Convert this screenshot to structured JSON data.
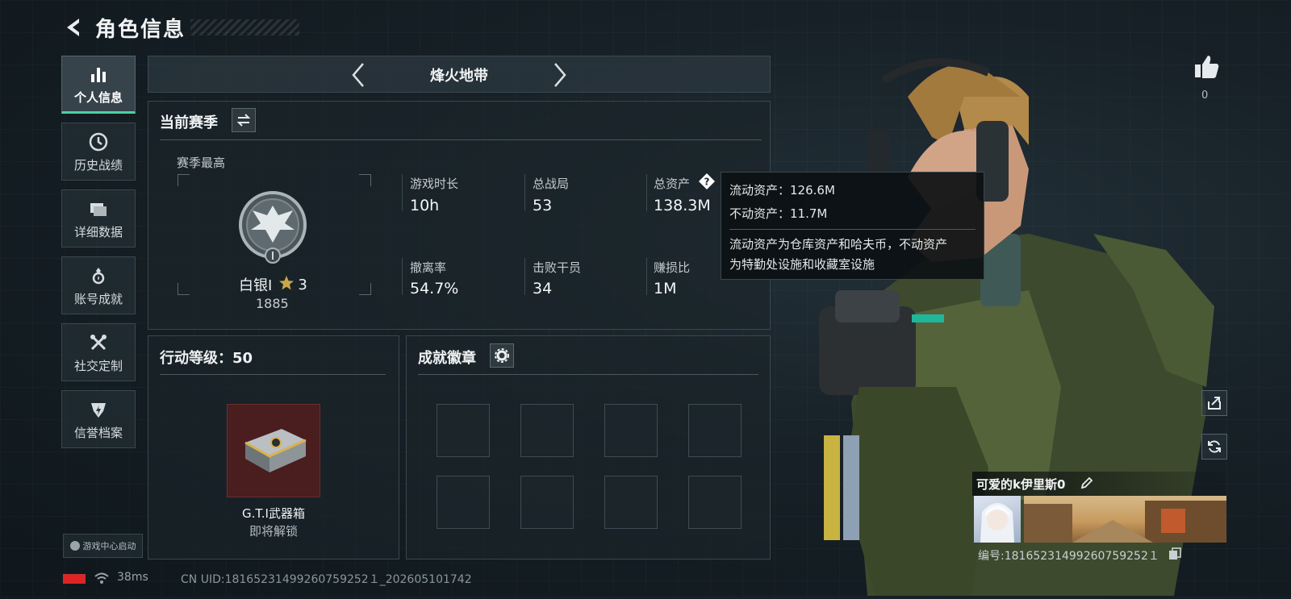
{
  "header": {
    "title": "角色信息"
  },
  "sidebar": {
    "items": [
      {
        "label": "个人信息",
        "icon": "bar-chart-icon"
      },
      {
        "label": "历史战绩",
        "icon": "clock-icon"
      },
      {
        "label": "详细数据",
        "icon": "folder-icon"
      },
      {
        "label": "账号成就",
        "icon": "trophy-icon"
      },
      {
        "label": "社交定制",
        "icon": "tools-icon"
      },
      {
        "label": "信誉档案",
        "icon": "shield-icon"
      }
    ],
    "launch_label": "游戏中心启动"
  },
  "mode": {
    "title": "烽火地带"
  },
  "season": {
    "title": "当前赛季",
    "best_label": "赛季最高",
    "rank_name": "白银I",
    "rank_stars": "3",
    "rank_score": "1885",
    "stats": [
      {
        "label": "游戏时长",
        "value": "10h"
      },
      {
        "label": "总战局",
        "value": "53"
      },
      {
        "label": "总资产",
        "value": "138.3M"
      },
      {
        "label": "撤离率",
        "value": "54.7%"
      },
      {
        "label": "击败干员",
        "value": "34"
      },
      {
        "label": "赚损比",
        "value": "1M"
      }
    ]
  },
  "tooltip": {
    "liquid": "流动资产：126.6M",
    "fixed": "不动资产：11.7M",
    "desc_line1": "流动资产为仓库资产和哈夫币，不动资产",
    "desc_line2": "为特勤处设施和收藏室设施"
  },
  "action_level": {
    "title": "行动等级：50",
    "reward_name": "G.T.I武器箱",
    "reward_status": "即将解锁"
  },
  "badges": {
    "title": "成就徽章",
    "slot_count": 8
  },
  "player": {
    "likes": "0",
    "name": "可爱的k伊里斯0",
    "id": "编号:18165231499260759252１"
  },
  "status_bar": {
    "ping": "38ms",
    "uid": "CN UID:18165231499260759252１_202605101742"
  },
  "colors": {
    "accent": "#4ed1a0",
    "battery": "#e02424",
    "panel_bg": "#1a242a"
  }
}
